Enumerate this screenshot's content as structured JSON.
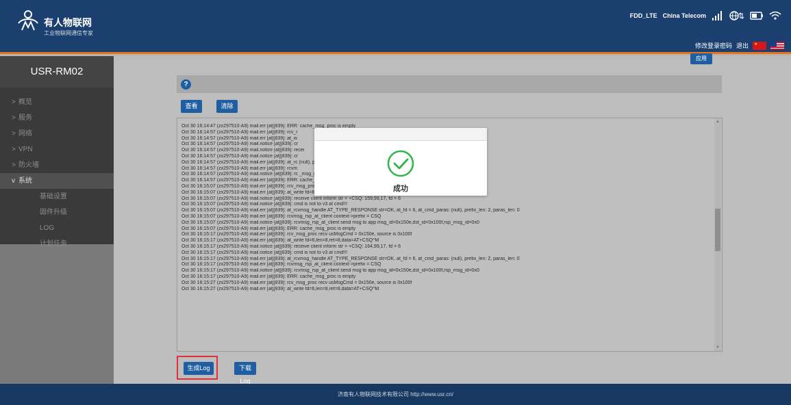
{
  "header": {
    "brand": "有人物联网",
    "slogan": "工业物联网通信专家",
    "network": "FDD_LTE",
    "carrier": "China Telecom",
    "links": {
      "change_password": "修改登录密码",
      "logout": "退出"
    }
  },
  "sidebar": {
    "device": "USR-RM02",
    "items": [
      {
        "label": "概览",
        "arrow": ">"
      },
      {
        "label": "服务",
        "arrow": ">"
      },
      {
        "label": "网络",
        "arrow": ">"
      },
      {
        "label": "VPN",
        "arrow": ">"
      },
      {
        "label": "防火墙",
        "arrow": ">"
      },
      {
        "label": "系统",
        "arrow": "v"
      }
    ],
    "subitems": [
      {
        "label": "基础设置"
      },
      {
        "label": "固件升级"
      },
      {
        "label": "LOG"
      },
      {
        "label": "计划任务"
      }
    ]
  },
  "main": {
    "apply": "应用",
    "help": "?",
    "buttons": {
      "view": "查看",
      "clear": "清除",
      "generate": "生成Log",
      "download": "下载Log"
    },
    "log_lines": [
      "Oct 30 16:14:47 (zx297510-A9) mail.err [at][839]: ERR: cache_msg_proc is empty",
      "Oct 30 16:14:57 (zx297510-A9) mail.err [at][839]: rcv_r",
      "Oct 30 16:14:57 (zx297510-A9) mail.err [at][839]: at_w",
      "Oct 30 16:14:57 (zx297510-A9) mail.notice [at][839]: cr",
      "Oct 30 16:14:57 (zx297510-A9) mail.notice [at][839]: recei",
      "Oct 30 16:14:57 (zx297510-A9) mail.notice [at][839]: cr",
      "Oct 30 16:14:57 (zx297510-A9) mail.err [at][839]: at_rc                                                                  (null), prefix_len: 2, paras_len: 0",
      "Oct 30 16:14:57 (zx297510-A9) mail.err [at][839]: rcvm",
      "Oct 30 16:14:57 (zx297510-A9) mail.notice [at][839]: rc                                                                  _msg_id=0x0",
      "Oct 30 16:14:57 (zx297510-A9) mail.err [at][839]: ERR: cache_msg_proc is empty",
      "Oct 30 16:15:07 (zx297510-A9) mail.err [at][839]: rcv_msg_proc recv usMsgCmd = 0x150e, source is 0x100f",
      "Oct 30 16:15:07 (zx297510-A9) mail.err [at][839]: at_write fd=6,len=8,ret=8,data=AT+CSQ^M",
      "Oct 30 16:15:07 (zx297510-A9) mail.notice [at][839]: receive client inform str = +CSQ: 159,99,17, fd = 6",
      "Oct 30 16:15:07 (zx297510-A9) mail.notice [at][839]: cmd is not to v3 at cmd!!!",
      "Oct 30 16:15:07 (zx297510-A9) mail.err [at][839]: at_rcvmsg_handle AT_TYPE_RESPONSE str=OK, at_fd = 6, at_cmd_paras: (null), prefix_len: 2, paras_len: 0",
      "Oct 30 16:15:07 (zx297510-A9) mail.err [at][839]: rcvmsg_rsp_at_client context->prefix = CSQ",
      "Oct 30 16:15:07 (zx297510-A9) mail.notice [at][839]: rcvmsg_rsp_at_client send msg to app msg_id=0x150e,dst_id=0x100f,rsp_msg_id=0x0",
      "Oct 30 16:15:07 (zx297510-A9) mail.err [at][839]: ERR: cache_msg_proc is empty",
      "Oct 30 16:15:17 (zx297510-A9) mail.err [at][839]: rcv_msg_proc recv usMsgCmd = 0x150e, source is 0x100f",
      "Oct 30 16:15:17 (zx297510-A9) mail.err [at][839]: at_write fd=6,len=8,ret=8,data=AT+CSQ^M",
      "Oct 30 16:15:17 (zx297510-A9) mail.notice [at][839]: receive client inform str = +CSQ: 164,99,17, fd = 6",
      "Oct 30 16:15:17 (zx297510-A9) mail.notice [at][839]: cmd is not to v3 at cmd!!!",
      "Oct 30 16:15:17 (zx297510-A9) mail.err [at][839]: at_rcvmsg_handle AT_TYPE_RESPONSE str=OK, at_fd = 6, at_cmd_paras: (null), prefix_len: 2, paras_len: 0",
      "Oct 30 16:15:17 (zx297510-A9) mail.err [at][839]: rcvmsg_rsp_at_client context->prefix = CSQ",
      "Oct 30 16:15:17 (zx297510-A9) mail.notice [at][839]: rcvmsg_rsp_at_client send msg to app msg_id=0x150e,dst_id=0x100f,rsp_msg_id=0x0",
      "Oct 30 16:15:17 (zx297510-A9) mail.err [at][839]: ERR: cache_msg_proc is empty",
      "Oct 30 16:15:27 (zx297510-A9) mail.err [at][839]: rcv_msg_proc recv usMsgCmd = 0x150e, source is 0x100f",
      "Oct 30 16:15:27 (zx297510-A9) mail.err [at][839]: at_write fd=6,len=8,ret=8,data=AT+CSQ^M"
    ]
  },
  "modal": {
    "message": "成功"
  },
  "footer": {
    "text": "济南有人物联网技术有限公司  http://www.usr.cn/"
  },
  "colors": {
    "header": "#1b3f6e",
    "accent": "#e8731a",
    "button": "#1f5fa1",
    "success": "#2fb34a"
  }
}
